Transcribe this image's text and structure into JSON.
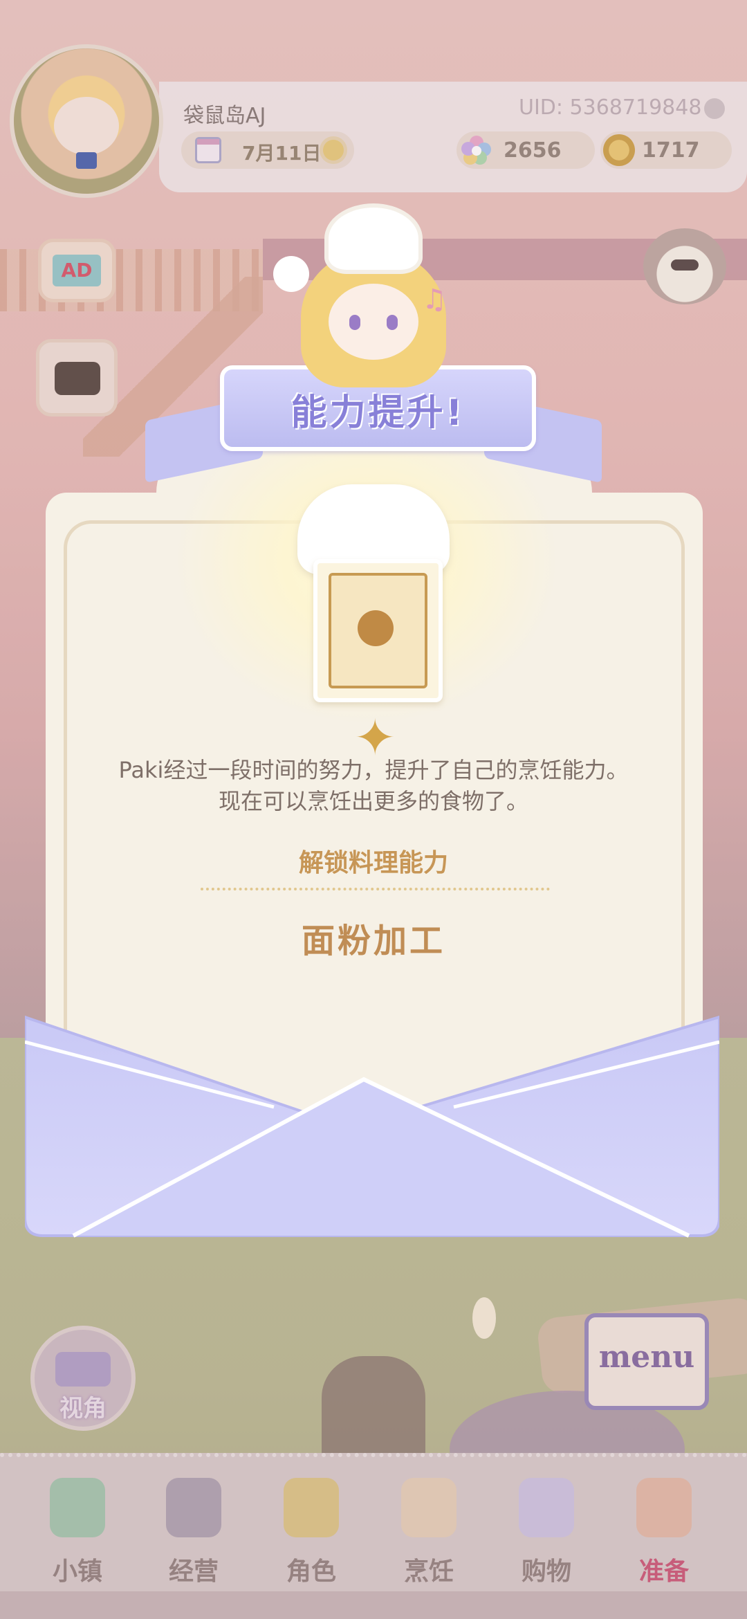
{
  "hud": {
    "player_name": "袋鼠岛AJ",
    "uid": "UID: 5368719848",
    "date": "7月11日",
    "gems": "2656",
    "coins": "1717"
  },
  "side": {
    "ad_label": "AD",
    "view_label": "视角",
    "menu_label": "menu"
  },
  "dialog": {
    "title": "能力提升!",
    "description_line1": "Paki经过一段时间的努力，提升了自己的烹饪能力。",
    "description_line2": "现在可以烹饪出更多的食物了。",
    "unlock_heading": "解锁料理能力",
    "unlock_item": "面粉加工"
  },
  "nav": {
    "items": [
      {
        "label": "小镇",
        "icon": "map-icon"
      },
      {
        "label": "经营",
        "icon": "locked-bag-icon"
      },
      {
        "label": "角色",
        "icon": "character-icon"
      },
      {
        "label": "烹饪",
        "icon": "sandwich-icon"
      },
      {
        "label": "购物",
        "icon": "shopping-bag-icon"
      },
      {
        "label": "准备",
        "icon": "basket-icon"
      }
    ],
    "active_index": 5
  },
  "colors": {
    "accent": "#8880d8",
    "gold": "#c08d55",
    "active_nav": "#c64b6d"
  }
}
